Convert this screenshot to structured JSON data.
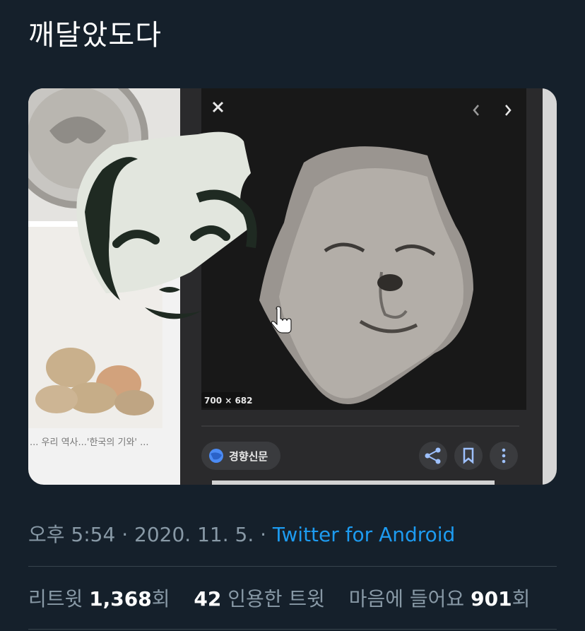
{
  "tweet": {
    "text": "깨달았도다"
  },
  "media": {
    "image_size_label": "700 × 682",
    "source_chip_label": "경향신문",
    "left_caption": "... 우리 역사...'한국의 기와' ..."
  },
  "meta": {
    "time": "오후 5:54",
    "separator_1": " · ",
    "date": "2020. 11. 5.",
    "separator_2": " · ",
    "source": "Twitter for Android"
  },
  "stats": {
    "retweets_label": "리트윗 ",
    "retweets_count": "1,368",
    "retweets_suffix": "회",
    "quotes_count": "42",
    "quotes_label": " 인용한 트윗",
    "likes_label": "마음에 들어요 ",
    "likes_count": "901",
    "likes_suffix": "회"
  },
  "colors": {
    "background": "#15202b",
    "accent": "#1d9bf0",
    "secondary_text": "#8899a6",
    "divider": "#38444d"
  }
}
